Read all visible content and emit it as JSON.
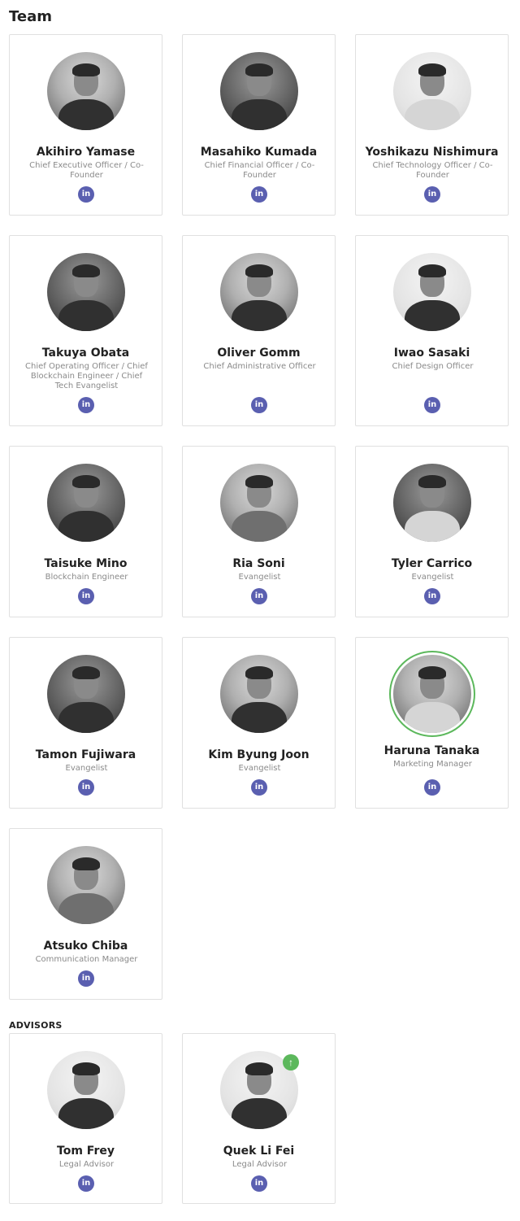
{
  "team_title": "Team",
  "advisors_title": "ADVISORS",
  "linkedin_icon_text": "in",
  "up_icon_text": "↑",
  "colors": {
    "linkedin": "#5a5fb0",
    "highlight": "#5cb85c"
  },
  "team": [
    {
      "name": "Akihiro Yamase",
      "role": "Chief Executive Officer / Co-Founder"
    },
    {
      "name": "Masahiko Kumada",
      "role": "Chief Financial Officer / Co-Founder"
    },
    {
      "name": "Yoshikazu Nishimura",
      "role": "Chief Technology Officer / Co-Founder"
    },
    {
      "name": "Takuya Obata",
      "role": "Chief Operating Officer / Chief Blockchain Engineer / Chief Tech Evangelist"
    },
    {
      "name": "Oliver Gomm",
      "role": "Chief Administrative Officer"
    },
    {
      "name": "Iwao Sasaki",
      "role": "Chief Design Officer"
    },
    {
      "name": "Taisuke Mino",
      "role": "Blockchain Engineer"
    },
    {
      "name": "Ria Soni",
      "role": "Evangelist"
    },
    {
      "name": "Tyler Carrico",
      "role": "Evangelist"
    },
    {
      "name": "Tamon Fujiwara",
      "role": "Evangelist"
    },
    {
      "name": "Kim Byung Joon",
      "role": "Evangelist"
    },
    {
      "name": "Haruna Tanaka",
      "role": "Marketing Manager"
    },
    {
      "name": "Atsuko Chiba",
      "role": "Communication Manager"
    }
  ],
  "advisors": [
    {
      "name": "Tom Frey",
      "role": "Legal Advisor"
    },
    {
      "name": "Quek Li Fei",
      "role": "Legal Advisor"
    }
  ]
}
